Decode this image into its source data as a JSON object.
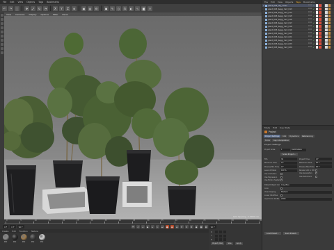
{
  "menubar": {
    "items": [
      "File",
      "Edit",
      "View",
      "Objects",
      "Tags",
      "Bookmarks"
    ]
  },
  "toolbar": {
    "icons": [
      "undo-icon",
      "redo-icon",
      "select-icon",
      "move-icon",
      "scale-icon",
      "rotate-icon",
      "recent-icon",
      "x-axis-icon",
      "y-axis-icon",
      "z-axis-icon",
      "coordinate-icon",
      "render-view-icon",
      "render-picture-queue-icon",
      "render-settings-icon",
      "cube-icon",
      "pen-icon",
      "subdivision-icon",
      "array-icon",
      "sky-icon",
      "deformer-icon",
      "camera-icon",
      "light-icon"
    ]
  },
  "viewport": {
    "menu": [
      "View",
      "Cameras",
      "Display",
      "Options",
      "Filter",
      "Panel"
    ],
    "status": "Grid Spacing : 10000 cm"
  },
  "timeline": {
    "ticks": [
      "0",
      "5",
      "10",
      "15",
      "20",
      "25",
      "30",
      "35",
      "40",
      "45",
      "50",
      "55",
      "60",
      "65",
      "70",
      "75",
      "80",
      "85",
      "90"
    ],
    "start_frame": "0 F",
    "current_frame": "0 F",
    "end_frame": "90 F",
    "range_end": "90 F",
    "buttons": [
      "go-start-icon",
      "prev-key-icon",
      "prev-frame-icon",
      "play-icon",
      "next-frame-icon",
      "next-key-icon",
      "go-end-icon"
    ],
    "key_buttons": [
      "record-icon",
      "autokey-icon",
      "keyframe-selection-icon",
      "position-key-icon",
      "scale-key-icon",
      "rotation-key-icon",
      "param-key-icon",
      "pla-key-icon",
      "scheme-icon"
    ]
  },
  "materials": {
    "menu": [
      "Create",
      "Edit",
      "Function",
      "Texture"
    ],
    "items": [
      {
        "name": "Mat",
        "color": "#8a8a8a"
      },
      {
        "name": "Mat",
        "color": "#2b2b2b"
      },
      {
        "name": "Mat",
        "color": "#9b7a4d"
      },
      {
        "name": "Mat",
        "color": "#3f3f3f"
      },
      {
        "name": "Mat",
        "color": "#cfcfcf"
      }
    ]
  },
  "coords": {
    "rows": [
      {
        "axis": "X"
      },
      {
        "axis": "Y"
      },
      {
        "axis": "Z"
      }
    ],
    "mode": "Object (Rel)",
    "size_mode": "Size",
    "apply": "Apply"
  },
  "objmgr": {
    "menu": [
      "File",
      "Edit",
      "View",
      "Objects",
      "Tags",
      "Bookmarks"
    ],
    "active": "Tags",
    "rows": [
      {
        "name": "plant_003_obj_collec",
        "expanded": true
      },
      {
        "name": "plant_003_bagg_mnt_013"
      },
      {
        "name": "plant_003_bagg_mnt_014"
      },
      {
        "name": "plant_003_bagg_mnt_015"
      },
      {
        "name": "plant_003_bagg_mnt_016"
      },
      {
        "name": "plant_003_bagg_mnt_017"
      },
      {
        "name": "plant_003_bagg_mnt_018"
      },
      {
        "name": "plant_003_bagg_mnt_019"
      },
      {
        "name": "plant_003_bagg_mnt_020"
      },
      {
        "name": "plant_003_bagg_mnt_021"
      },
      {
        "name": "plant_003_bagg_mnt_022"
      },
      {
        "name": "plant_003_bagg_mnt_023"
      },
      {
        "name": "plant_003_bagg_mnt_024"
      }
    ],
    "tag_colors": [
      "#f4f4f4",
      "#d94b3a",
      "#2a2a2a",
      "#d9d9d9",
      "#c48a3b",
      "#3b3b3b"
    ]
  },
  "attrs": {
    "menu": [
      "Mode",
      "Edit",
      "User Data"
    ],
    "title": "Project",
    "tabs": [
      "Project Settings",
      "Info",
      "Dynamics",
      "Referencing"
    ],
    "tabs_row2": [
      "To Do",
      "Key Interpolation"
    ],
    "section": "Project Settings",
    "scale_label": "Project Scale",
    "scale_value": "1",
    "scale_unit": "Centimeters",
    "scale_button": "Scale Project...",
    "left_fields": [
      {
        "label": "FPS",
        "value": "30"
      },
      {
        "label": "Minimum Time",
        "value": "0 F"
      },
      {
        "label": "Preview Min Time",
        "value": "0 F"
      },
      {
        "label": "Level of Detail",
        "value": "100 %"
      },
      {
        "label": "Use Animation",
        "value": ""
      },
      {
        "label": "Use Expression",
        "value": ""
      },
      {
        "label": "Use Motion System",
        "value": ""
      }
    ],
    "right_fields": [
      {
        "label": "Project Time",
        "value": "0 F"
      },
      {
        "label": "Maximum Time",
        "value": "90 F"
      },
      {
        "label": "Preview Max Time",
        "value": "90 F"
      },
      {
        "label": "Render LOD in Editor",
        "value": ""
      },
      {
        "label": "Use Generators",
        "value": ""
      },
      {
        "label": "Use Deformers",
        "value": ""
      }
    ],
    "extra_fields": [
      {
        "label": "Default Object Color",
        "value": "Gray-Blue"
      },
      {
        "label": "Color",
        "value": ""
      },
      {
        "label": "View Clipping",
        "value": "Medium"
      },
      {
        "label": "Linear Workflow",
        "value": ""
      },
      {
        "label": "Input Color Profile",
        "value": "sRGB"
      }
    ],
    "bottom_buttons": [
      "Load Preset...",
      "Save Preset..."
    ]
  }
}
